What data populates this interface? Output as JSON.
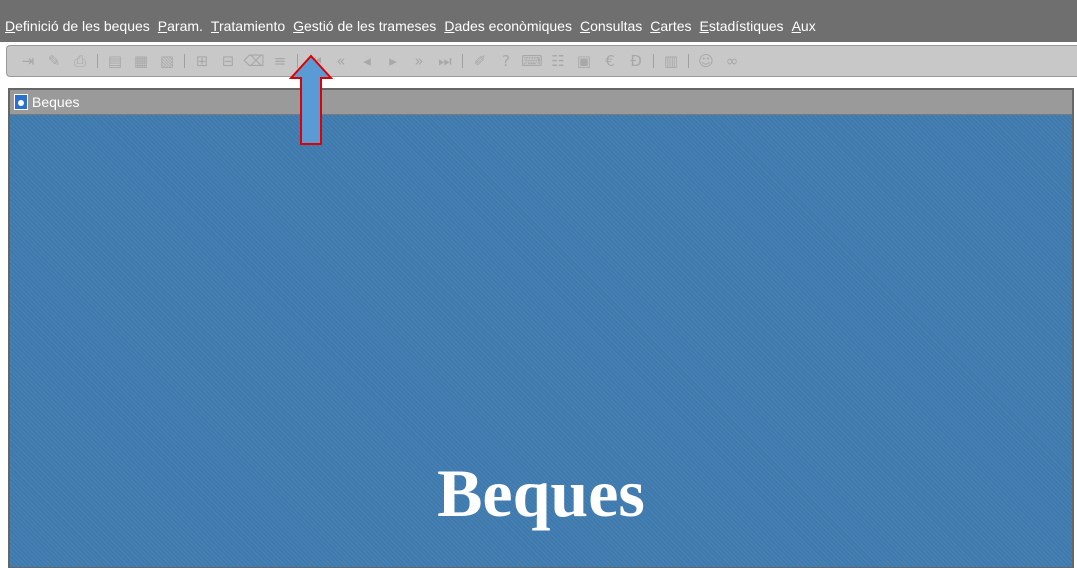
{
  "menubar": {
    "items": [
      {
        "mnemonic": "D",
        "rest": "efinició de les beques"
      },
      {
        "mnemonic": "P",
        "rest": "aram."
      },
      {
        "mnemonic": "T",
        "rest": "ratamiento"
      },
      {
        "mnemonic": "G",
        "rest": "estió de les trameses"
      },
      {
        "mnemonic": "D",
        "rest": "ades econòmiques"
      },
      {
        "mnemonic": "C",
        "rest": "onsultas"
      },
      {
        "mnemonic": "C",
        "rest": "artes"
      },
      {
        "mnemonic": "E",
        "rest": "stadístiques"
      },
      {
        "mnemonic": "A",
        "rest": "ux"
      }
    ]
  },
  "toolbar": {
    "icons": [
      "exit-icon",
      "save-icon",
      "print-icon",
      "sep",
      "query-icon",
      "query-enter-icon",
      "query-execute-icon",
      "sep",
      "insert-record-icon",
      "delete-record-icon",
      "clear-record-icon",
      "clear-block-icon",
      "sep",
      "first-record-icon",
      "previous-block-icon",
      "previous-record-icon",
      "next-record-icon",
      "next-block-icon",
      "last-record-icon",
      "sep",
      "edit-icon",
      "help-icon",
      "keys-help-icon",
      "list-values-icon",
      "calendar-icon",
      "euro-icon",
      "translate-icon",
      "sep",
      "notes-icon",
      "sep",
      "user-icon",
      "link-icon"
    ]
  },
  "window": {
    "title": "Beques",
    "heading": "Beques"
  },
  "annotation": {
    "arrow_color": "#5b9bd5",
    "arrow_border": "#e00000"
  }
}
